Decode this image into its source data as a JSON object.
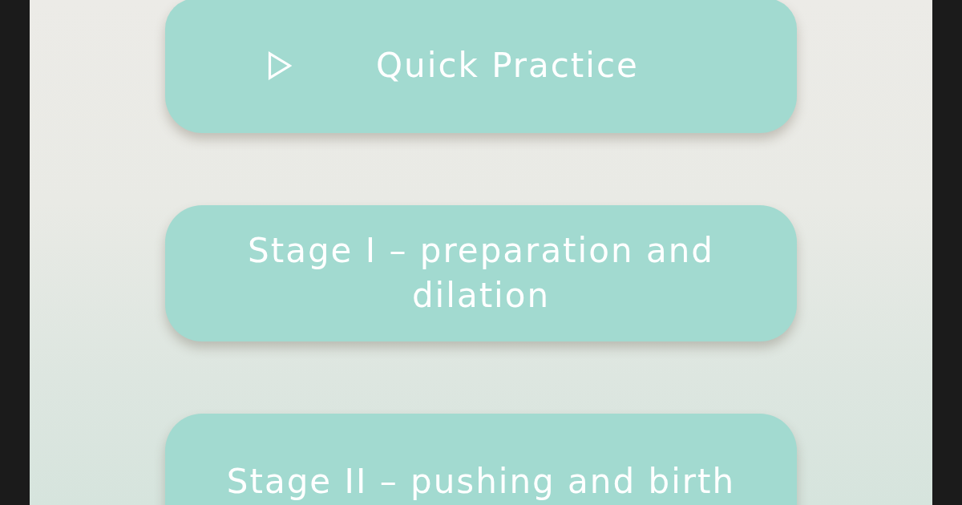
{
  "buttons": [
    {
      "kind": "play",
      "label": "Quick Practice"
    },
    {
      "kind": "plain",
      "label": "Stage I – preparation and dilation"
    },
    {
      "kind": "plain",
      "label": "Stage II – pushing and birth"
    }
  ]
}
